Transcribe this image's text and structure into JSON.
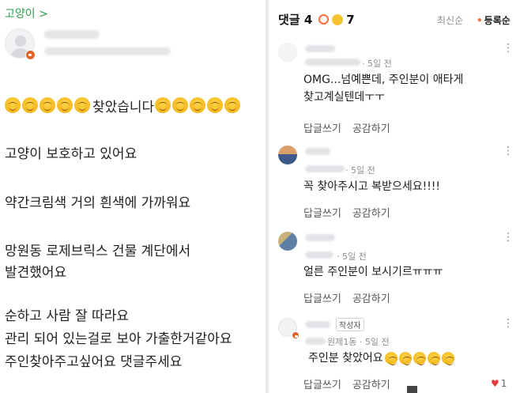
{
  "post": {
    "category": "고양이 >",
    "found_text": "찾았습니다",
    "lines": [
      "고양이 보호하고 있어요",
      "약간크림색 거의 흰색에 가까워요",
      "망원동 로제브릭스 건물 계단에서",
      "발견했어요",
      "순하고 사람 잘 따라요",
      "관리 되어 있는걸로 보아 가출한거같아요",
      "주인찾아주고싶어요 댓글주세요"
    ]
  },
  "comments_panel": {
    "title": "댓글 4",
    "count": "7",
    "sort_recent": "최신순",
    "sort_registered": "등록순",
    "accent_color": "#ff6e3a",
    "comments": [
      {
        "meta": "· 5일 전",
        "text_lines": [
          "OMG...넘예쁜데, 주인분이 애타게",
          "찾고계실텐데ㅜㅜ"
        ],
        "reply": "답글쓰기",
        "like": "공감하기"
      },
      {
        "meta": "· 5일 전",
        "text_lines": [
          "꼭 찾아주시고 복받으세요!!!!"
        ],
        "reply": "답글쓰기",
        "like": "공감하기"
      },
      {
        "meta": "· 5일 전",
        "text_lines": [
          "얼른 주인분이 보시기르ㅠㅠㅠ"
        ],
        "reply": "답글쓰기",
        "like": "공감하기"
      },
      {
        "author_tag": "작성자",
        "meta_location": "원제1동 · 5일 전",
        "text": "주인분 찾았어요",
        "reply": "답글쓰기",
        "like": "공감하기",
        "likes": "1"
      }
    ]
  }
}
